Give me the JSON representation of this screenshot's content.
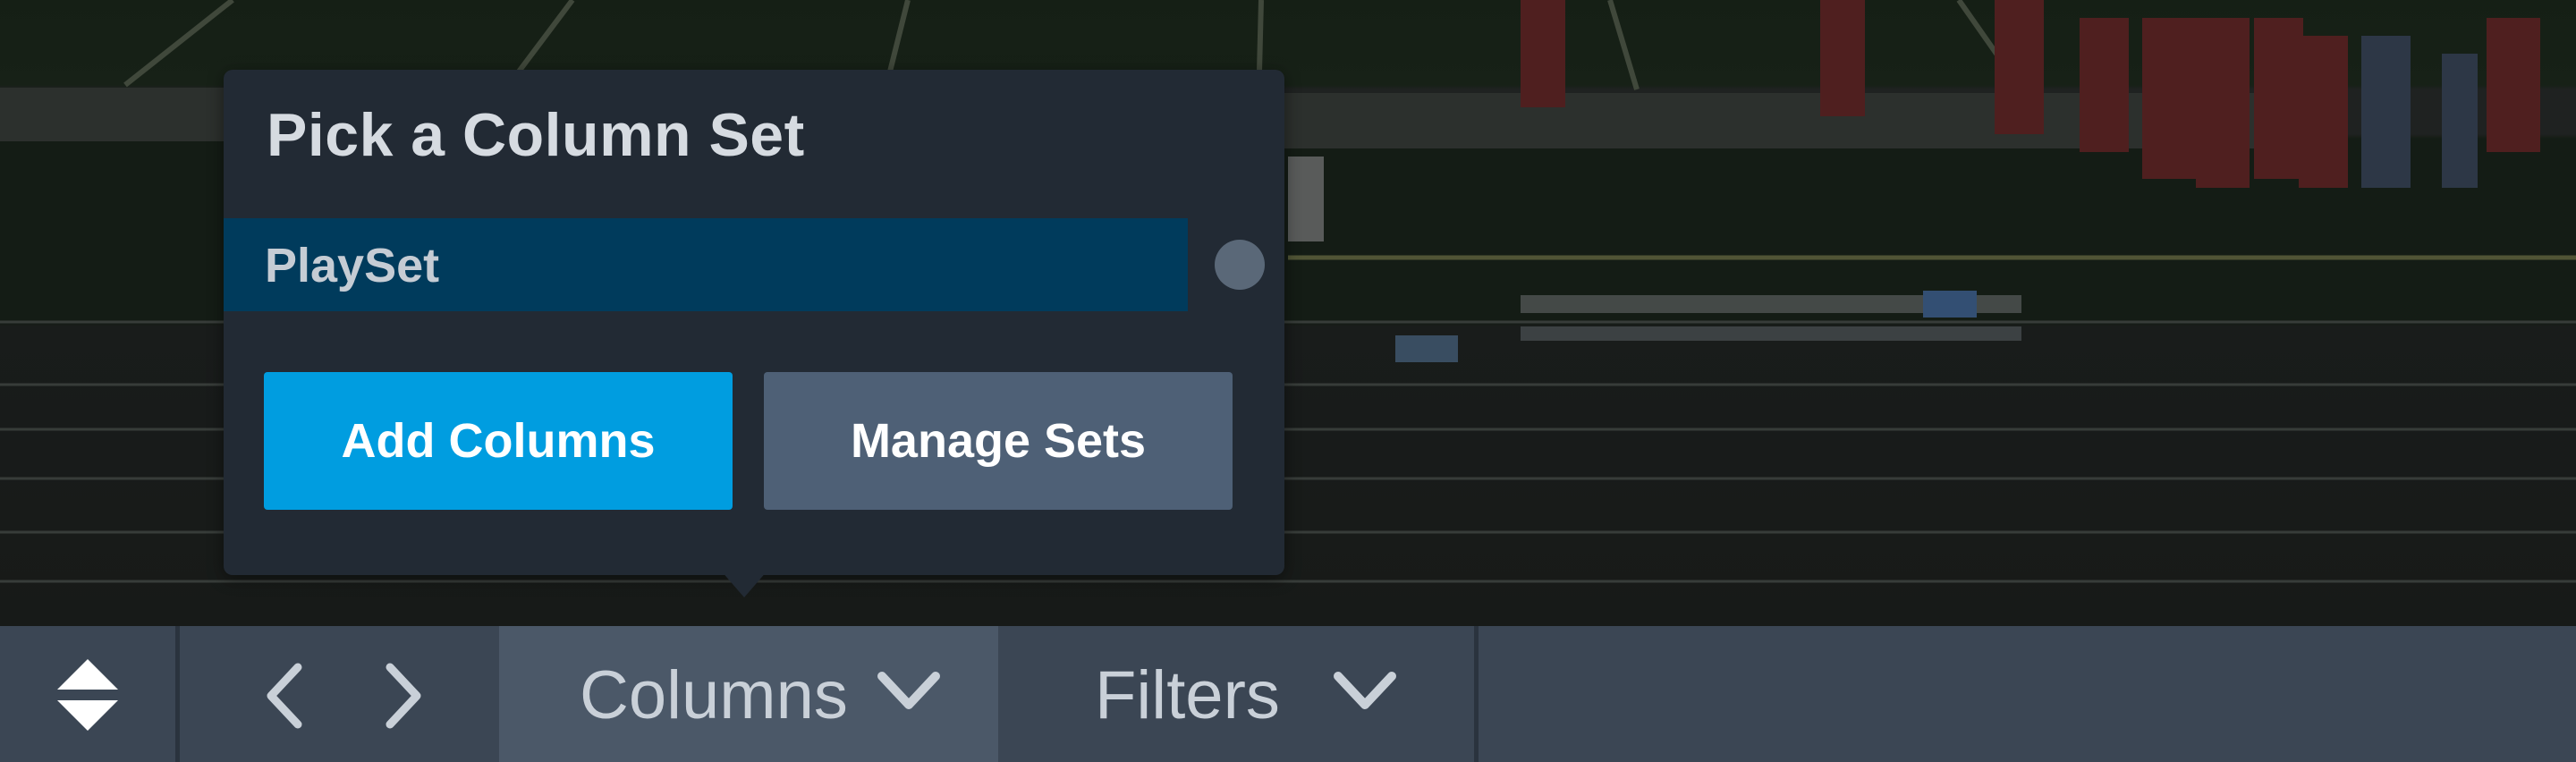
{
  "popover": {
    "title": "Pick a Column Set",
    "column_sets": [
      {
        "label": "PlaySet",
        "selected": true
      }
    ],
    "add_columns_label": "Add Columns",
    "manage_sets_label": "Manage Sets"
  },
  "toolbar": {
    "sort_toggle_icon": "sort-up-down-icon",
    "prev_icon": "chevron-left-icon",
    "next_icon": "chevron-right-icon",
    "columns_label": "Columns",
    "filters_label": "Filters",
    "chevron_icon": "chevron-down-icon"
  },
  "colors": {
    "popover_bg": "#222a34",
    "selected_row": "#003b5c",
    "primary_button": "#009de0",
    "secondary_button": "#4e6076",
    "toolbar_bg": "#3b4654",
    "active_tab_bg": "#4b5868"
  }
}
